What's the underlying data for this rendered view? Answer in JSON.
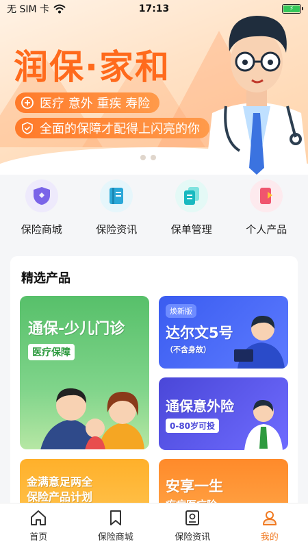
{
  "status_bar": {
    "carrier": "无 SIM 卡",
    "time": "17:13"
  },
  "banner": {
    "title": "润保·家和",
    "line1": "医疗 意外 重疾 寿险",
    "line2": "全面的保障才配得上闪亮的你",
    "dots": 3,
    "active_dot": 3
  },
  "quick_nav": [
    {
      "label": "保险商城",
      "icon": "shop-shield-icon"
    },
    {
      "label": "保险资讯",
      "icon": "news-book-icon"
    },
    {
      "label": "保单管理",
      "icon": "policy-docs-icon"
    },
    {
      "label": "个人产品",
      "icon": "personal-product-icon"
    }
  ],
  "featured": {
    "title": "精选产品",
    "products": [
      {
        "title": "通保-少儿门诊",
        "tag": "医疗保障"
      },
      {
        "badge": "焕新版",
        "title": "达尔文5号",
        "sub": "（不含身故）"
      },
      {
        "title": "通保意外险",
        "sub": "0-80岁可投"
      },
      {
        "title": "金满意足两全",
        "sub": "保险产品计划"
      },
      {
        "title": "安享一生",
        "sub": "疾病医疗险"
      }
    ]
  },
  "tabbar": [
    {
      "label": "首页",
      "icon": "home-icon"
    },
    {
      "label": "保险商城",
      "icon": "bookmark-icon"
    },
    {
      "label": "保险资讯",
      "icon": "news-icon"
    },
    {
      "label": "我的",
      "icon": "user-icon",
      "active": true
    }
  ],
  "colors": {
    "accent": "#f07a22",
    "banner_orange": "#ff6a1c"
  }
}
